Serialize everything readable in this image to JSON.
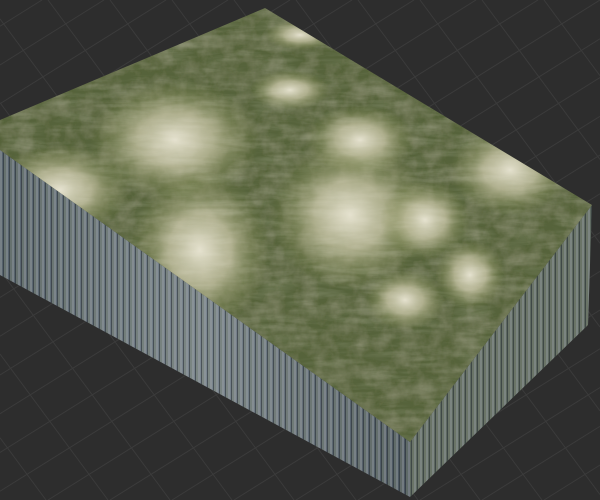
{
  "scene": {
    "background_color": "#2d2d2d",
    "grid_color": "#3b3b3b",
    "terrain_base_color": "#5b6a3a",
    "terrain_dark_color": "#2f3520",
    "terrain_peak_color": "#e4e0cc",
    "side_colors": [
      "#6f7a86",
      "#3f4a52",
      "#9aa0a0",
      "#2b3236",
      "#7c8670",
      "#556070"
    ]
  }
}
